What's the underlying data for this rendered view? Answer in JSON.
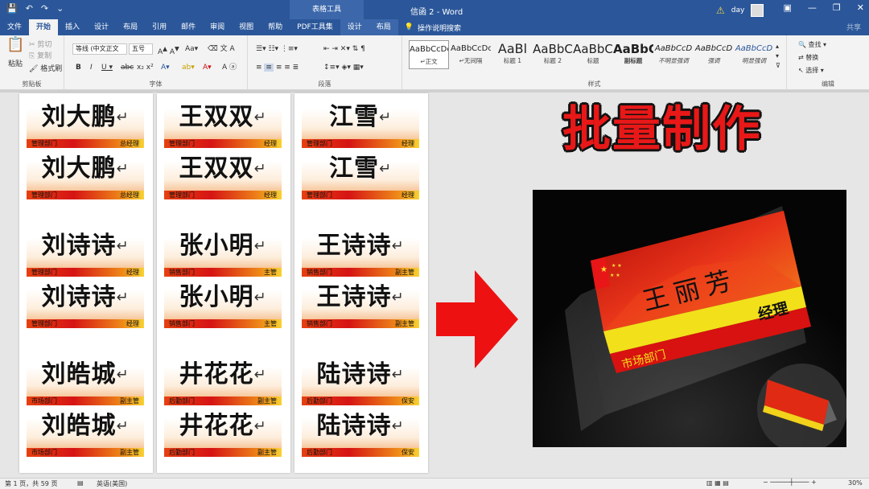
{
  "titlebar": {
    "qat": [
      "💾",
      "↶",
      "↷",
      "⌄"
    ],
    "context_title": "表格工具",
    "doc_title": "信函 2 - Word",
    "user": "day"
  },
  "tabs": [
    "文件",
    "开始",
    "插入",
    "设计",
    "布局",
    "引用",
    "邮件",
    "审阅",
    "视图",
    "帮助",
    "PDF工具集"
  ],
  "context_tabs": [
    "设计",
    "布局"
  ],
  "tell_me": "操作说明搜索",
  "share": "共享",
  "ribbon": {
    "clipboard": {
      "paste": "粘贴",
      "cut": "剪切",
      "copy": "复制",
      "format_painter": "格式刷",
      "label": "剪贴板"
    },
    "font": {
      "font_name": "等线 (中文正文",
      "font_size": "五号",
      "label": "字体"
    },
    "paragraph": {
      "label": "段落"
    },
    "styles": {
      "label": "样式",
      "items": [
        {
          "preview": "AaBbCcDc",
          "name": "↵正文"
        },
        {
          "preview": "AaBbCcDc",
          "name": "↵无间隔"
        },
        {
          "preview": "AaBl",
          "name": "标题 1"
        },
        {
          "preview": "AaBbC",
          "name": "标题 2"
        },
        {
          "preview": "AaBbC",
          "name": "标题"
        },
        {
          "preview": "AaBbC",
          "name": "副标题"
        },
        {
          "preview": "AaBbCcD",
          "name": "不明显强调"
        },
        {
          "preview": "AaBbCcD",
          "name": "强调"
        },
        {
          "preview": "AaBbCcD",
          "name": "明显强调"
        }
      ]
    },
    "editing": {
      "find": "查找",
      "replace": "替换",
      "select": "选择",
      "label": "编辑"
    }
  },
  "pages": [
    [
      {
        "name": "刘大鹏",
        "dept": "管理部门",
        "title": "总经理"
      },
      {
        "name": "刘诗诗",
        "dept": "管理部门",
        "title": "经理"
      },
      {
        "name": "刘皓城",
        "dept": "市场部门",
        "title": "副主管"
      }
    ],
    [
      {
        "name": "王双双",
        "dept": "管理部门",
        "title": "经理"
      },
      {
        "name": "张小明",
        "dept": "销售部门",
        "title": "主管"
      },
      {
        "name": "井花花",
        "dept": "后勤部门",
        "title": "副主管"
      }
    ],
    [
      {
        "name": "江雪",
        "dept": "管理部门",
        "title": "经理"
      },
      {
        "name": "王诗诗",
        "dept": "销售部门",
        "title": "副主管"
      },
      {
        "name": "陆诗诗",
        "dept": "后勤部门",
        "title": "保安"
      }
    ]
  ],
  "headline": "批量制作",
  "photo": {
    "name": "王丽芳",
    "title": "经理",
    "dept": "市场部门"
  },
  "status": {
    "page": "第 1 页，共 59 页",
    "language": "英语(美国)",
    "zoom": "30%"
  },
  "colors": {
    "title_bar": "#2b579a",
    "band_red": "#d61414",
    "band_yellow": "#f8d233",
    "headline": "#e81818"
  }
}
